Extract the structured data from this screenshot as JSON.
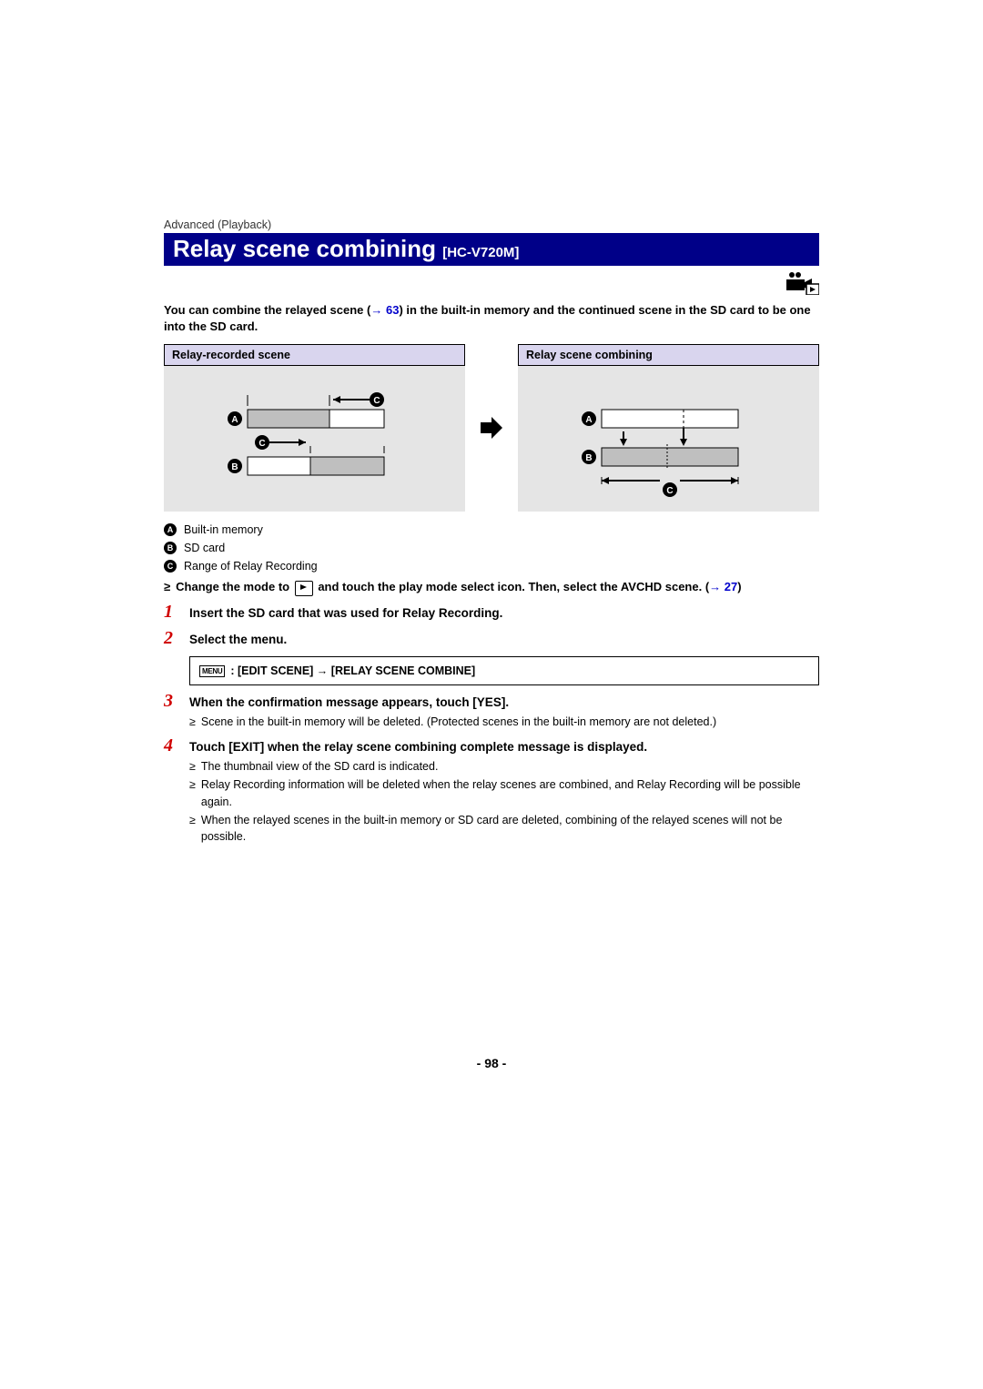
{
  "breadcrumb": "Advanced (Playback)",
  "title_main": "Relay scene combining ",
  "title_sub": "[HC-V720M]",
  "intro": {
    "t1": "You can combine the relayed scene (",
    "xref_arrow": "→ ",
    "xref_num": "63",
    "t2": ") in the built-in memory and the continued scene in the SD card to be one into the SD card."
  },
  "table_heads": {
    "left": "Relay-recorded scene",
    "right": "Relay scene combining"
  },
  "legend": {
    "a": "Built-in memory",
    "b": "SD card",
    "c": "Range of Relay Recording"
  },
  "mode_line": {
    "t1": "Change the mode to ",
    "t2": " and touch the play mode select icon. Then, select the AVCHD scene. (",
    "xref_arrow": "→ ",
    "xref_num": "27",
    "t3": ")"
  },
  "steps": {
    "s1": "Insert the SD card that was used for Relay Recording.",
    "s2": "Select the menu.",
    "s3": "When the confirmation message appears, touch [YES].",
    "s3_sub": "Scene in the built-in memory will be deleted. (Protected scenes in the built-in memory are not deleted.)",
    "s4": "Touch [EXIT] when the relay scene combining complete message is displayed.",
    "s4_sub1": "The thumbnail view of the SD card is indicated.",
    "s4_sub2": "Relay Recording information will be deleted when the relay scenes are combined, and Relay Recording will be possible again.",
    "s4_sub3": "When the relayed scenes in the built-in memory or SD card are deleted, combining of the relayed scenes will not be possible."
  },
  "menu_box": {
    "menu_label": "MENU",
    "path": ": [EDIT SCENE] → [RELAY SCENE COMBINE]"
  },
  "page_number": "- 98 -",
  "letters": {
    "a": "A",
    "b": "B",
    "c": "C"
  },
  "bullet_dot": "≥"
}
